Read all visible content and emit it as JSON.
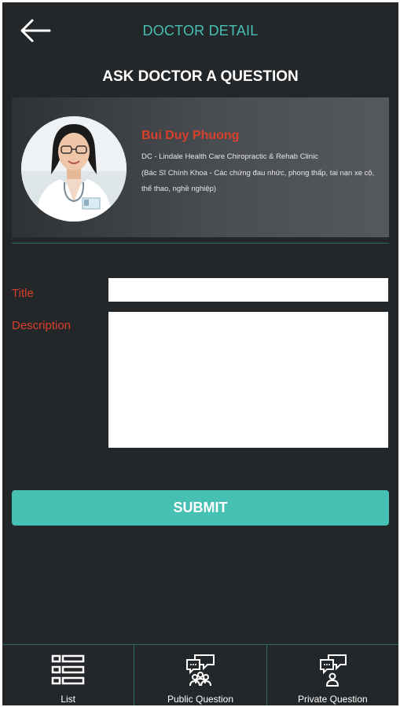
{
  "header": {
    "back_icon": "arrow-left-icon",
    "title": "DOCTOR DETAIL"
  },
  "page": {
    "title": "ASK DOCTOR A QUESTION"
  },
  "doctor": {
    "name": "Bui Duy Phuong",
    "clinic": "DC - Lindale Health Care Chiropractic & Rehab Clinic",
    "description": "(Bác Sĩ Chính Khoa - Các chứng đau nhức, phong thấp, tai nạn xe cộ, thể thao, nghề nghiệp)"
  },
  "form": {
    "title_label": "Title",
    "title_value": "",
    "description_label": "Description",
    "description_value": "",
    "submit_label": "SUBMIT"
  },
  "nav": {
    "items": [
      {
        "label": "List",
        "icon": "list-icon"
      },
      {
        "label": "Public Question",
        "icon": "public-question-icon"
      },
      {
        "label": "Private Question",
        "icon": "private-question-icon"
      }
    ]
  },
  "colors": {
    "background": "#24272a",
    "accent": "#46c0b3",
    "label": "#d9402b",
    "divider": "#2d6c66"
  }
}
